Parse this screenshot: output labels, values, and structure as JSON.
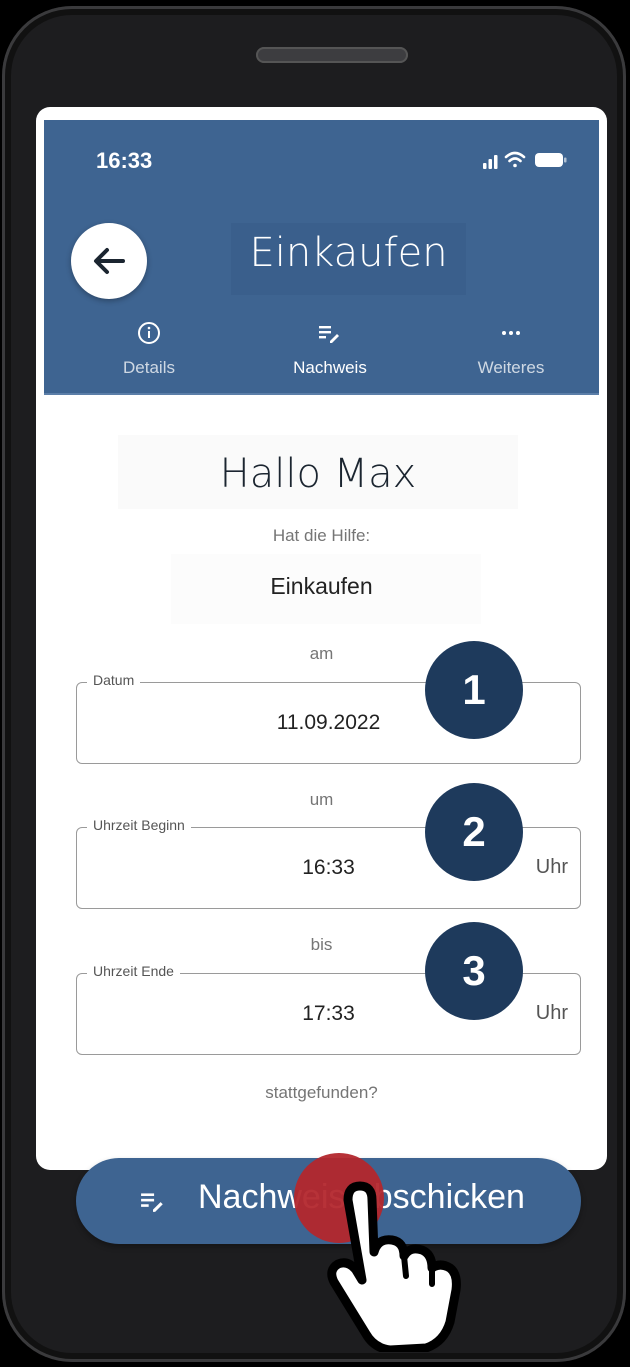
{
  "status": {
    "time": "16:33"
  },
  "header": {
    "back_icon": "arrow-left-icon",
    "title": "Einkaufen",
    "tabs": [
      {
        "label": "Details",
        "icon": "info-circle-icon",
        "active": false
      },
      {
        "label": "Nachweis",
        "icon": "list-edit-icon",
        "active": true
      },
      {
        "label": "Weiteres",
        "icon": "more-horizontal-icon",
        "active": false
      }
    ]
  },
  "content": {
    "greeting": "Hallo Max",
    "prompt": "Hat die Hilfe:",
    "help_name": "Einkaufen",
    "connector_am": "am",
    "connector_um": "um",
    "connector_bis": "bis",
    "closing": "stattgefunden?",
    "fields": {
      "date": {
        "label": "Datum",
        "value": "11.09.2022"
      },
      "start": {
        "label": "Uhrzeit Beginn",
        "value": "16:33",
        "unit": "Uhr"
      },
      "end": {
        "label": "Uhrzeit Ende",
        "value": "17:33",
        "unit": "Uhr"
      }
    },
    "badges": [
      "1",
      "2",
      "3"
    ],
    "submit_label": "Nachweis abschicken"
  },
  "colors": {
    "primary": "#3e6491",
    "badge": "#1e3a5c",
    "tap": "#b3272d"
  }
}
